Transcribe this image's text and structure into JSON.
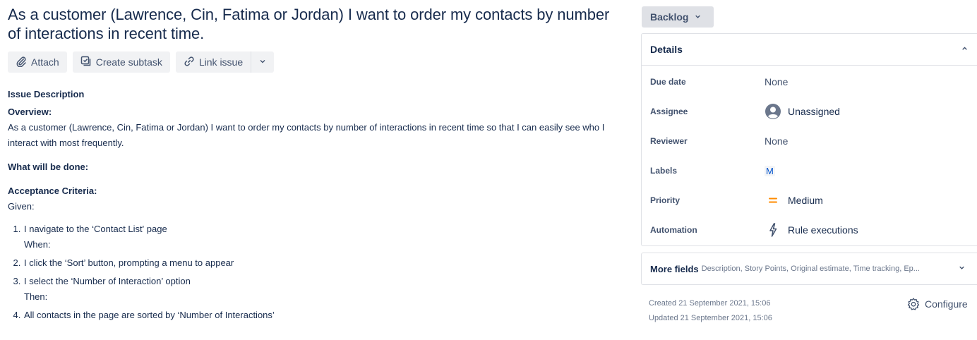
{
  "issue": {
    "title": "As a customer (Lawrence, Cin, Fatima or Jordan) I want to order my contacts by number of interactions in recent time."
  },
  "actions": {
    "attach": "Attach",
    "create_subtask": "Create subtask",
    "link_issue": "Link issue",
    "icons": [
      "paperclip-icon",
      "subtask-icon",
      "link-icon",
      "chevron-down-icon"
    ]
  },
  "description": {
    "heading": "Issue Description",
    "overview_heading": "Overview:",
    "overview_text": "As a customer (Lawrence, Cin, Fatima or Jordan) I want to order my contacts by number of interactions in recent time so that I can easily see who I interact with most frequently.",
    "done_heading": "What will be done:",
    "criteria_heading": "Acceptance Criteria:",
    "given": "Given:",
    "steps": [
      {
        "text": "I navigate to the ‘Contact List' page",
        "after": "When:"
      },
      {
        "text": "I click the ‘Sort’ button, prompting a menu to appear",
        "after": ""
      },
      {
        "text": "I select the ‘Number of Interaction’ option",
        "after": "Then:"
      },
      {
        "text": "All contacts in the page are sorted by ‘Number of Interactions’",
        "after": ""
      }
    ]
  },
  "status": {
    "label": "Backlog"
  },
  "details": {
    "title": "Details",
    "due_date": {
      "label": "Due date",
      "value": "None"
    },
    "assignee": {
      "label": "Assignee",
      "value": "Unassigned",
      "icon": "avatar-icon"
    },
    "reviewer": {
      "label": "Reviewer",
      "value": "None"
    },
    "labels": {
      "label": "Labels",
      "value": "M"
    },
    "priority": {
      "label": "Priority",
      "value": "Medium",
      "color": "#ff8b00"
    },
    "automation": {
      "label": "Automation",
      "value": "Rule executions",
      "icon": "lightning-icon"
    }
  },
  "more_fields": {
    "title": "More fields",
    "summary": "Description, Story Points, Original estimate, Time tracking, Ep..."
  },
  "meta": {
    "created": "Created 21 September 2021, 15:06",
    "updated": "Updated 21 September 2021, 15:06",
    "configure": "Configure"
  },
  "colors": {
    "text": "#172b4d",
    "subtle": "#42526e",
    "muted": "#6b778c",
    "button_bg": "#f1f2f4",
    "status_bg": "#dfe1e6",
    "link": "#0052cc"
  }
}
